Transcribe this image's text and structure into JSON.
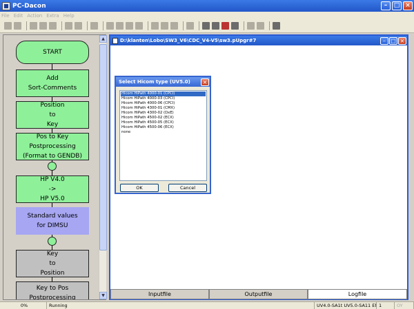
{
  "window": {
    "title": "PC-Dacon"
  },
  "menu": [
    {
      "label": "File"
    },
    {
      "label": "Edit"
    },
    {
      "label": "Action"
    },
    {
      "label": "Extra"
    },
    {
      "label": "Help"
    }
  ],
  "flow": {
    "start": "START",
    "add_sort": "Add\nSort-Comments",
    "pos_to_key": "Position\nto\nKey",
    "pos_to_key_post": "Pos to Key\nPostprocessing\n(Format to GENDB)",
    "hp_version": "HP V4.0\n->\nHP V5.0",
    "standard_values": "Standard values\nfor DIMSU",
    "key_to_pos": "Key\nto\nPosition",
    "key_to_pos_post": "Key to Pos\nPostprocessing"
  },
  "document": {
    "title": "D:\\klanten\\Lobo\\SW3_V6\\CDC_V4-V5\\sw3.pUpgr#7",
    "tabs": [
      {
        "label": "Inputfile"
      },
      {
        "label": "Outputfile"
      },
      {
        "label": "Logfile"
      }
    ],
    "active_tab": "Logfile"
  },
  "dialog": {
    "title": "Select Hicom type (UV5.0)",
    "options": [
      "Hicom HiPath 4000-01 (CPCI)",
      "Hicom HiPath 4000-03 (CPCI)",
      "Hicom HiPath 4000-06 (CPCI)",
      "Hicom HiPath 4300-01 (CMX)",
      "Hicom HiPath 4300-02 (DxE)",
      "Hicom HiPath 4500-02 (ECX)",
      "Hicom HiPath 4500-05 (ECX)",
      "Hicom HiPath 4500-06 (ECX)",
      "none"
    ],
    "selected_index": 0,
    "ok_label": "OK",
    "cancel_label": "Cancel"
  },
  "status": {
    "progress": "0%",
    "state": "Running",
    "version": "UV4.0-SA1t UV5.0-SA11 ENG",
    "page": "1",
    "mode": "OY"
  },
  "icons": {
    "app": "pc-dacon-app-icon",
    "document": "document-icon"
  },
  "colors": {
    "title_bar": "#2257c9",
    "flow_green": "#8ff09a",
    "flow_blue": "#a6a6f2",
    "flow_gray": "#c0c0c0",
    "selection": "#316ac5"
  }
}
